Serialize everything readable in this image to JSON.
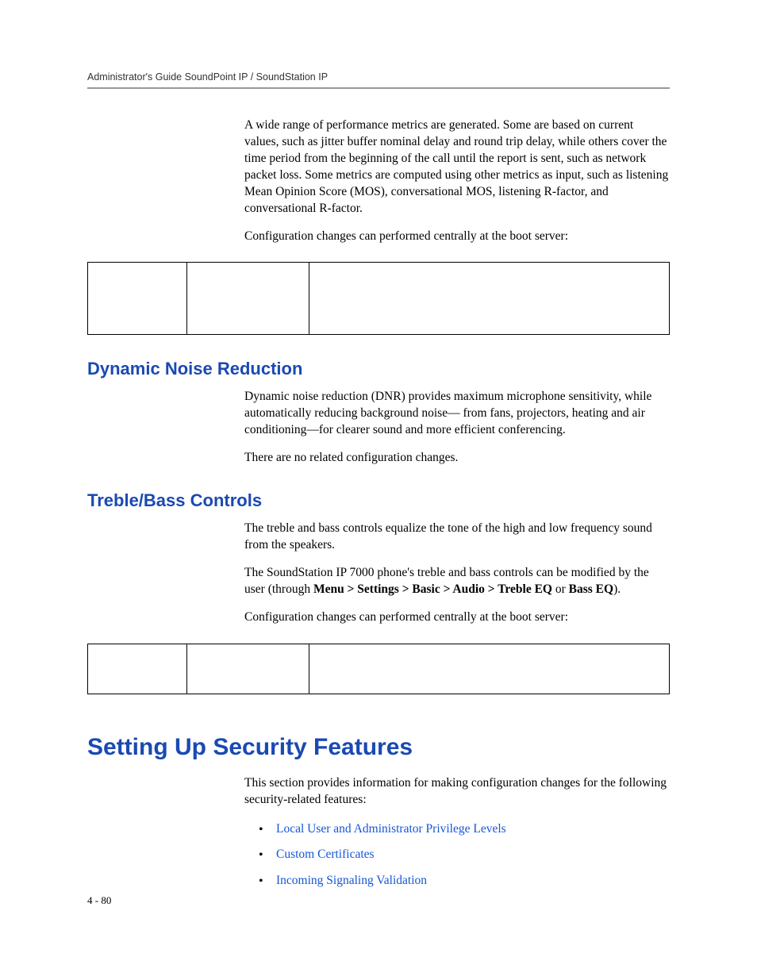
{
  "header": {
    "running": "Administrator's Guide SoundPoint IP / SoundStation IP"
  },
  "intro": {
    "p1": "A wide range of performance metrics are generated. Some are based on current values, such as jitter buffer nominal delay and round trip delay, while others cover the time period from the beginning of the call until the report is sent, such as network packet loss. Some metrics are computed using other metrics as input, such as listening Mean Opinion Score (MOS), conversational MOS, listening R-factor, and conversational R-factor.",
    "p2": "Configuration changes can performed centrally at the boot server:"
  },
  "dnr": {
    "title": "Dynamic Noise Reduction",
    "p1": "Dynamic noise reduction (DNR) provides maximum microphone sensitivity, while automatically reducing background noise— from fans, projectors, heating and air conditioning—for clearer sound and more efficient conferencing.",
    "p2": "There are no related configuration changes."
  },
  "treble": {
    "title": "Treble/Bass Controls",
    "p1": "The treble and bass controls equalize the tone of the high and low frequency sound from the speakers.",
    "p2a": "The SoundStation IP 7000 phone's treble and bass controls can be modified by the user (through ",
    "p2b_bold": "Menu > Settings > Basic > Audio > Treble EQ",
    "p2c": " or ",
    "p2d_bold": "Bass EQ",
    "p2e": ").",
    "p3": "Configuration changes can performed centrally at the boot server:"
  },
  "security": {
    "title": "Setting Up Security Features",
    "p1": "This section provides information for making configuration changes for the following security-related features:",
    "links": {
      "l1": "Local User and Administrator Privilege Levels",
      "l2": "Custom Certificates",
      "l3": "Incoming Signaling Validation"
    }
  },
  "footer": {
    "pagenum": "4 - 80"
  }
}
